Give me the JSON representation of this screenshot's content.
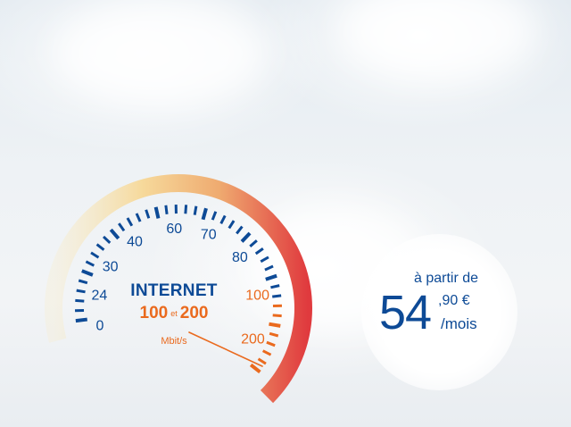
{
  "gauge": {
    "title": "INTERNET",
    "speed_low": "100",
    "speed_connector": "et",
    "speed_high": "200",
    "unit": "Mbit/s",
    "tick_labels": [
      "0",
      "24",
      "30",
      "40",
      "60",
      "70",
      "80",
      "100",
      "200"
    ],
    "needle_value": "200",
    "colors": {
      "blue": "#0d4a96",
      "orange": "#ea6a1e",
      "arc_start": "#f6e3b8",
      "arc_mid": "#f0b276",
      "arc_end": "#e03a3e"
    }
  },
  "offer": {
    "prefix": "à partir de",
    "price_main": "54",
    "price_cents": ",90 €",
    "period": "/mois"
  }
}
